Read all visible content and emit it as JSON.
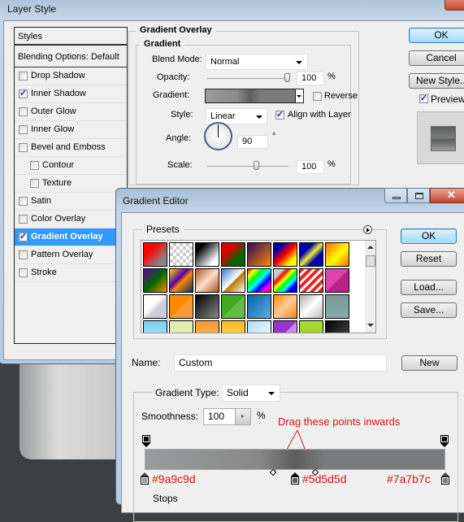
{
  "layer_style": {
    "title": "Layer Style",
    "styles_header": "Styles",
    "blending_options": "Blending Options: Default",
    "items": [
      {
        "label": "Drop Shadow",
        "checked": false
      },
      {
        "label": "Inner Shadow",
        "checked": true
      },
      {
        "label": "Outer Glow",
        "checked": false
      },
      {
        "label": "Inner Glow",
        "checked": false
      },
      {
        "label": "Bevel and Emboss",
        "checked": false
      },
      {
        "label": "Contour",
        "checked": false,
        "sub": true
      },
      {
        "label": "Texture",
        "checked": false,
        "sub": true
      },
      {
        "label": "Satin",
        "checked": false
      },
      {
        "label": "Color Overlay",
        "checked": false
      },
      {
        "label": "Gradient Overlay",
        "checked": true,
        "selected": true
      },
      {
        "label": "Pattern Overlay",
        "checked": false
      },
      {
        "label": "Stroke",
        "checked": false
      }
    ],
    "section_title": "Gradient Overlay",
    "subsection_title": "Gradient",
    "blend_mode_label": "Blend Mode:",
    "blend_mode": "Normal",
    "opacity_label": "Opacity:",
    "opacity": "100",
    "opacity_unit": "%",
    "gradient_label": "Gradient:",
    "reverse_label": "Reverse",
    "reverse": false,
    "style_label": "Style:",
    "style": "Linear",
    "align_label": "Align with Layer",
    "align": true,
    "angle_label": "Angle:",
    "angle": "90",
    "angle_unit": "°",
    "scale_label": "Scale:",
    "scale": "100",
    "scale_unit": "%",
    "ok": "OK",
    "cancel": "Cancel",
    "new_style": "New Style...",
    "preview_label": "Preview",
    "preview": true
  },
  "gradient_editor": {
    "title": "Gradient Editor",
    "presets_label": "Presets",
    "ok": "OK",
    "reset": "Reset",
    "load": "Load...",
    "save": "Save...",
    "name_label": "Name:",
    "name": "Custom",
    "new": "New",
    "type_label": "Gradient Type:",
    "type": "Solid",
    "smoothness_label": "Smoothness:",
    "smoothness": "100",
    "smoothness_unit": "%",
    "stops_label": "Stops",
    "annotation": "Drag these points inwards",
    "color_stops": [
      {
        "label": "#9a9c9d",
        "color": "#9a9c9d",
        "location": 0
      },
      {
        "label": "#5d5d5d",
        "color": "#5d5d5d",
        "location": 50
      },
      {
        "label": "#7a7b7c",
        "color": "#7a7b7c",
        "location": 100
      }
    ]
  },
  "colors": {
    "selection": "#3399ff",
    "annotation": "#e01010"
  }
}
